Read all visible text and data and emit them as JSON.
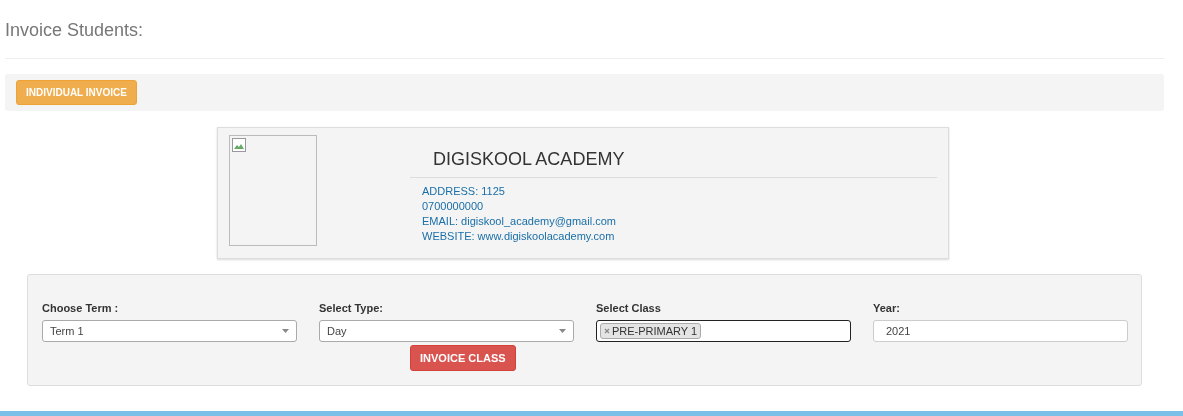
{
  "page": {
    "title": "Invoice Students:"
  },
  "toolbar": {
    "buttons": [
      {
        "label": "INDIVIDUAL INVOICE",
        "kind": "warning"
      }
    ]
  },
  "school": {
    "name": "DIGISKOOL ACADEMY",
    "details": [
      "ADDRESS: 1125",
      "0700000000",
      "EMAIL: digiskool_academy@gmail.com",
      "WEBSITE: www.digiskoolacademy.com"
    ]
  },
  "form": {
    "fields": [
      {
        "kind": "select",
        "label": "Choose Term :",
        "value": "Term 1",
        "focused": false
      },
      {
        "kind": "select",
        "label": "Select Type:",
        "value": "Day",
        "focused": false
      },
      {
        "kind": "multiselect",
        "label": "Select Class",
        "tags": [
          "PRE-PRIMARY 1"
        ],
        "focused": true
      },
      {
        "kind": "text",
        "label": "Year:",
        "value": "2021",
        "focused": false
      }
    ],
    "submit": {
      "label": "INVOICE CLASS",
      "kind": "danger"
    }
  }
}
